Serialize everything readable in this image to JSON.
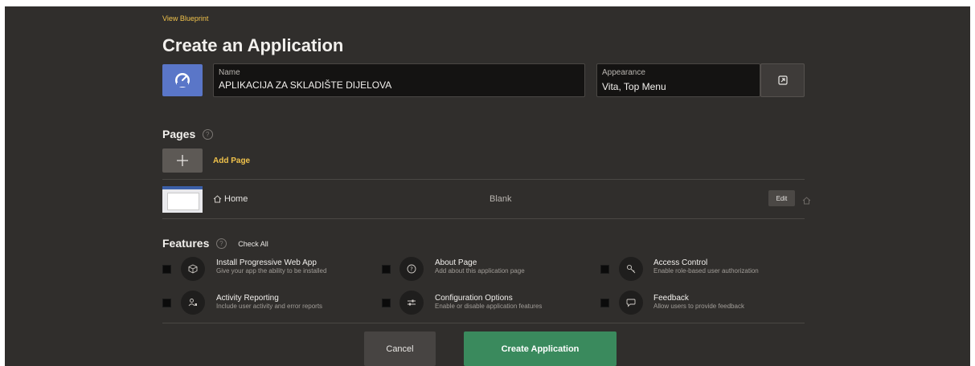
{
  "header": {
    "blueprint_link": "View Blueprint",
    "title": "Create an Application"
  },
  "app": {
    "icon": "gauge-icon",
    "icon_color": "#5a76c8",
    "name_label": "Name",
    "name_value": "APLIKACIJA ZA SKLADIŠTE DIJELOVA",
    "appearance_label": "Appearance",
    "appearance_value": "Vita, Top Menu"
  },
  "pages": {
    "title": "Pages",
    "help": "?",
    "add_page_label": "Add Page",
    "items": [
      {
        "name": "Home",
        "type": "Blank",
        "edit_label": "Edit"
      }
    ]
  },
  "features": {
    "title": "Features",
    "help": "?",
    "check_all_label": "Check All",
    "items": [
      {
        "title": "Install Progressive Web App",
        "desc": "Give your app the ability to be installed",
        "icon": "cube-icon"
      },
      {
        "title": "About Page",
        "desc": "Add about this application page",
        "icon": "question-icon"
      },
      {
        "title": "Access Control",
        "desc": "Enable role-based user authorization",
        "icon": "key-icon"
      },
      {
        "title": "Activity Reporting",
        "desc": "Include user activity and error reports",
        "icon": "user-activity-icon"
      },
      {
        "title": "Configuration Options",
        "desc": "Enable or disable application features",
        "icon": "sliders-icon"
      },
      {
        "title": "Feedback",
        "desc": "Allow users to provide feedback",
        "icon": "speech-bubble-icon"
      }
    ]
  },
  "footer": {
    "cancel_label": "Cancel",
    "create_label": "Create Application",
    "create_color": "#3a8a5d"
  }
}
